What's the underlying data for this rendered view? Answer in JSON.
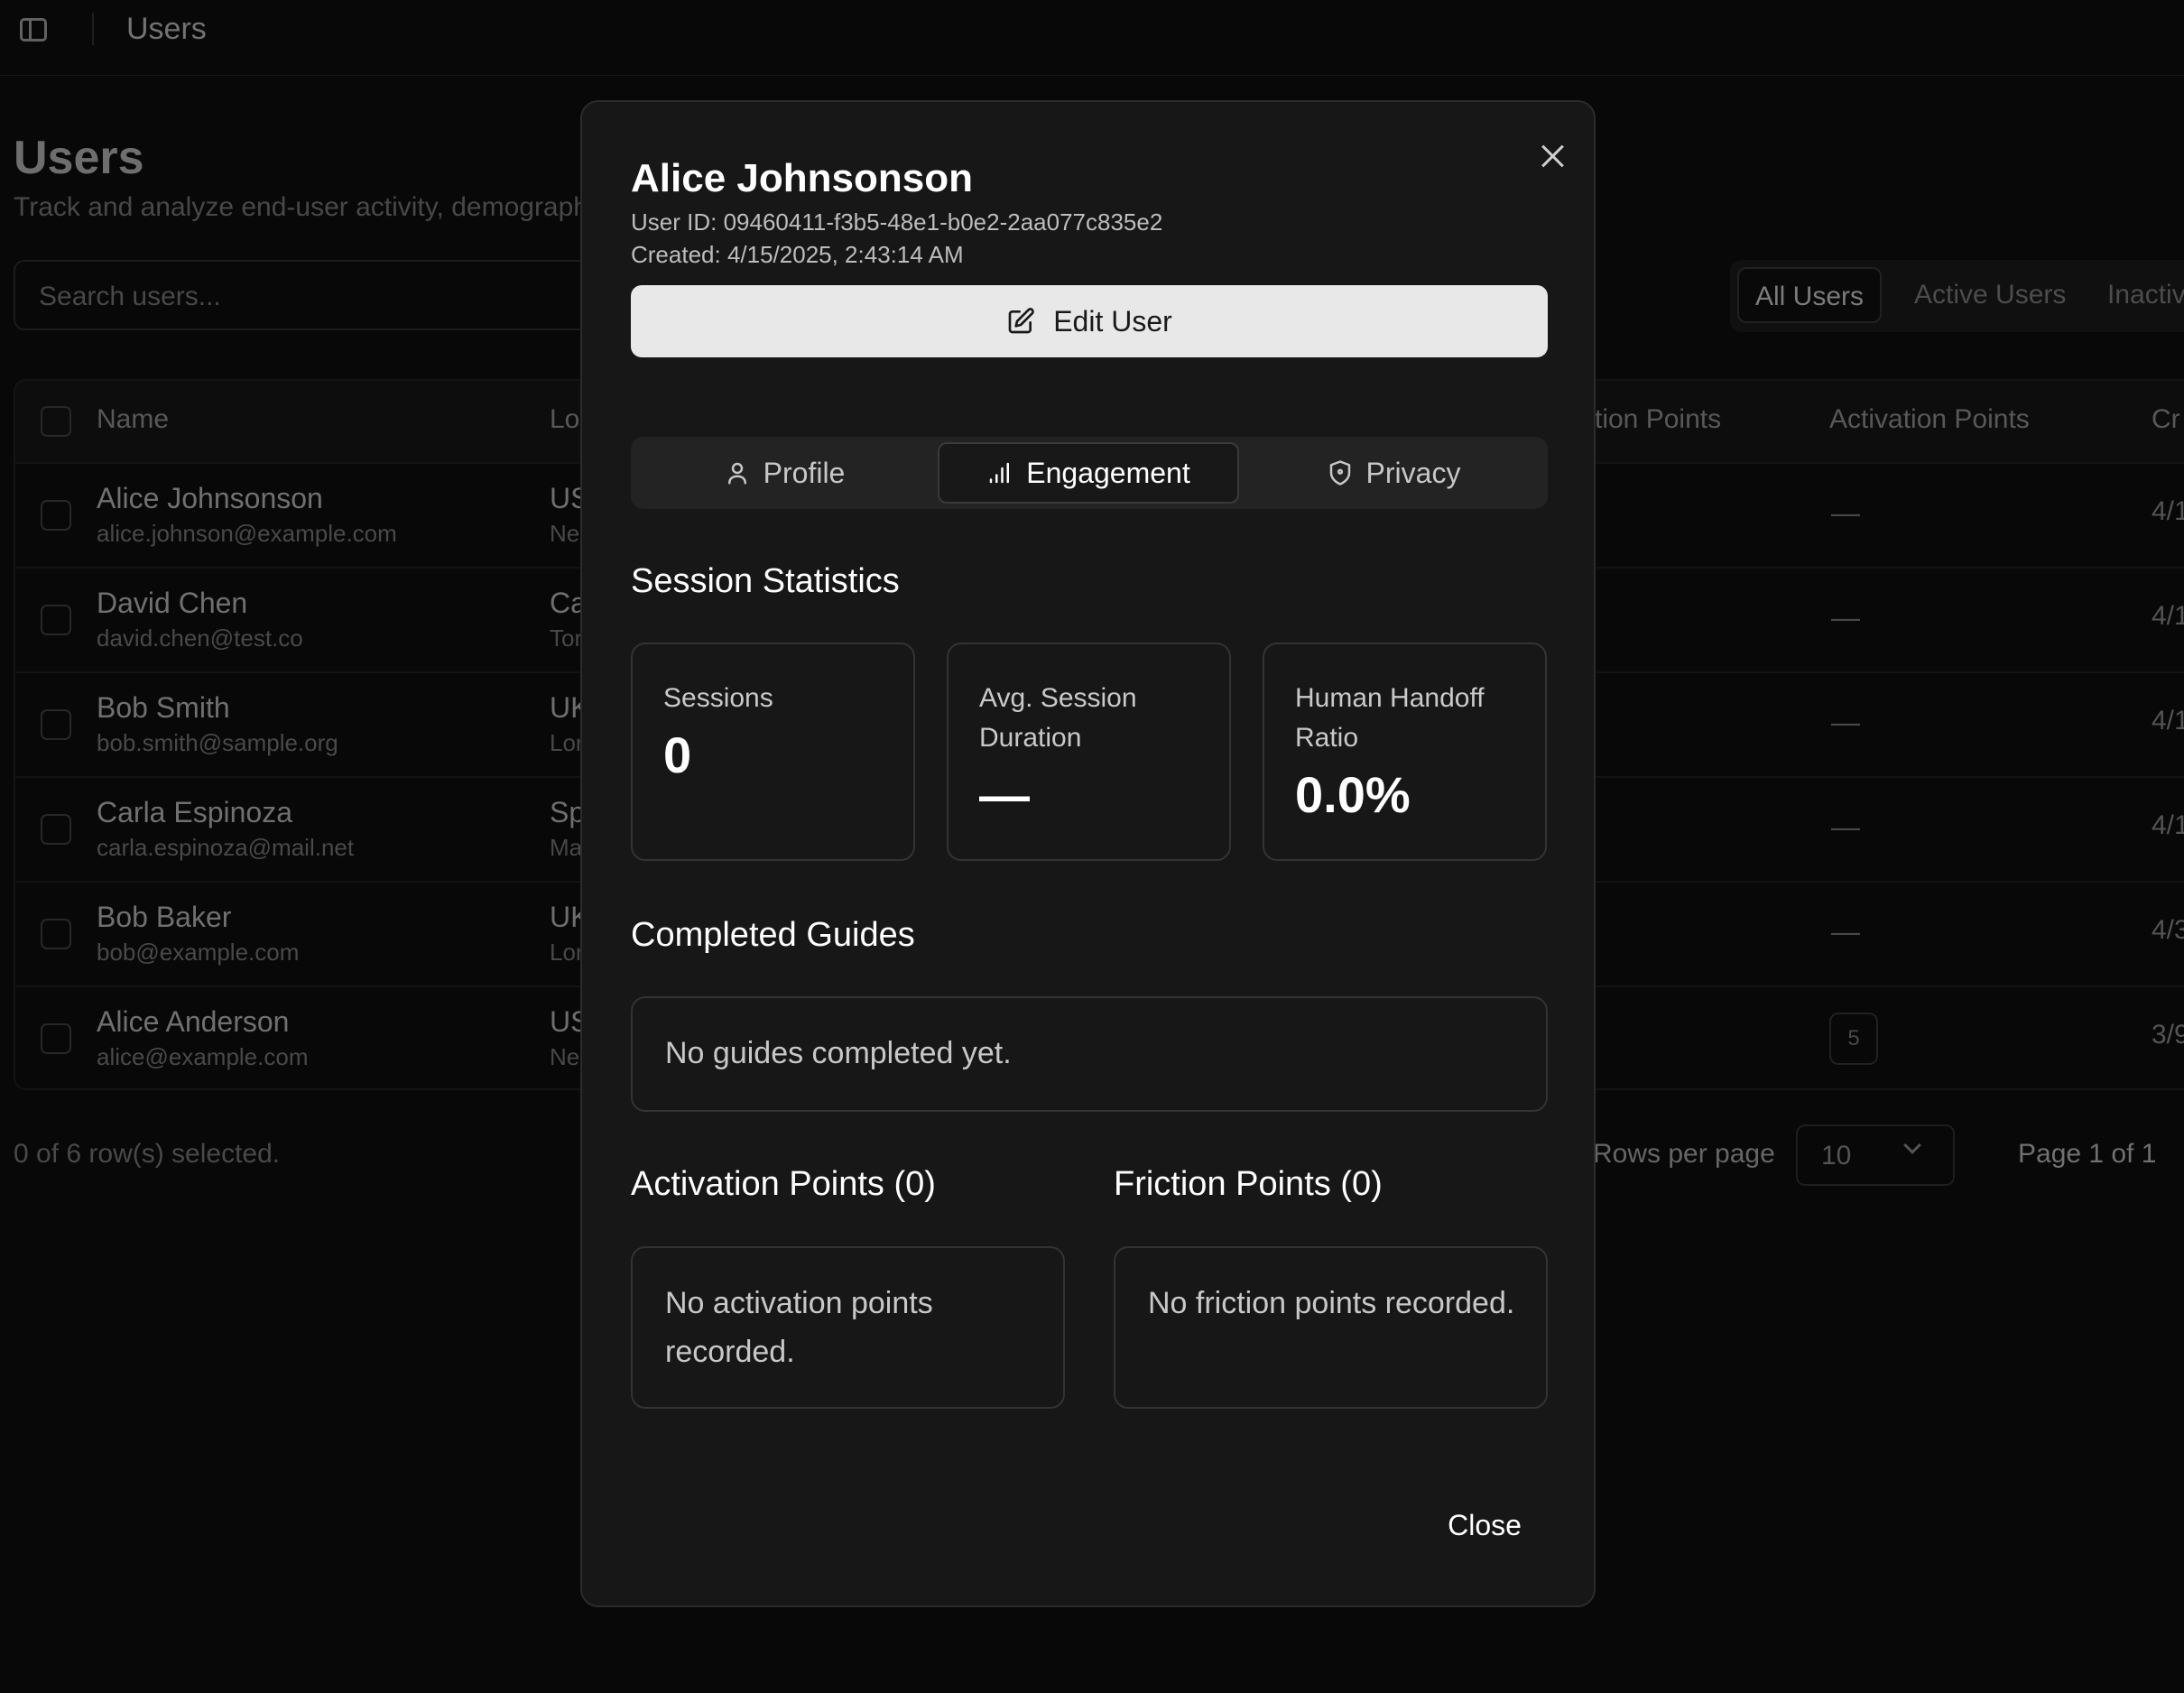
{
  "topbar": {
    "title": "Users"
  },
  "page": {
    "title": "Users",
    "subtitle": "Track and analyze end-user activity, demograph",
    "search_placeholder": "Search users...",
    "filters": [
      "All Users",
      "Active Users",
      "Inactive"
    ],
    "columns": {
      "name": "Name",
      "location": "Lo",
      "friction": "tion Points",
      "activation": "Activation Points",
      "created": "Cr"
    },
    "rows": [
      {
        "name": "Alice Johnsonson",
        "email": "alice.johnson@example.com",
        "loc": "US",
        "city": "Ne",
        "activation": "—",
        "created": "4/1"
      },
      {
        "name": "David Chen",
        "email": "david.chen@test.co",
        "loc": "Ca",
        "city": "Tor",
        "activation": "—",
        "created": "4/1"
      },
      {
        "name": "Bob Smith",
        "email": "bob.smith@sample.org",
        "loc": "UK",
        "city": "Lor",
        "activation": "—",
        "created": "4/1"
      },
      {
        "name": "Carla Espinoza",
        "email": "carla.espinoza@mail.net",
        "loc": "Sp",
        "city": "Ma",
        "activation": "—",
        "created": "4/1"
      },
      {
        "name": "Bob Baker",
        "email": "bob@example.com",
        "loc": "UK",
        "city": "Lor",
        "activation": "—",
        "created": "4/3"
      },
      {
        "name": "Alice Anderson",
        "email": "alice@example.com",
        "loc": "US",
        "city": "Ne",
        "activation": "5",
        "created": "3/9"
      }
    ],
    "selected_count": "0 of 6 row(s) selected.",
    "rows_per_page_label": "Rows per page",
    "rows_per_page_value": "10",
    "page_indicator": "Page 1 of 1"
  },
  "modal": {
    "name": "Alice Johnsonson",
    "user_id": "User ID: 09460411-f3b5-48e1-b0e2-2aa077c835e2",
    "created": "Created: 4/15/2025, 2:43:14 AM",
    "edit_label": "Edit User",
    "tabs": [
      {
        "label": "Profile",
        "icon": "user-icon"
      },
      {
        "label": "Engagement",
        "icon": "bar-chart-icon",
        "active": true
      },
      {
        "label": "Privacy",
        "icon": "shield-icon"
      }
    ],
    "session_title": "Session Statistics",
    "stats": [
      {
        "label": "Sessions",
        "value": "0"
      },
      {
        "label": "Avg. Session Duration",
        "value": "—"
      },
      {
        "label": "Human Handoff Ratio",
        "value": "0.0%"
      }
    ],
    "guides_title": "Completed Guides",
    "guides_empty": "No guides completed yet.",
    "activation_title": "Activation Points (0)",
    "activation_empty": "No activation points recorded.",
    "friction_title": "Friction Points (0)",
    "friction_empty": "No friction points recorded.",
    "close_label": "Close"
  }
}
